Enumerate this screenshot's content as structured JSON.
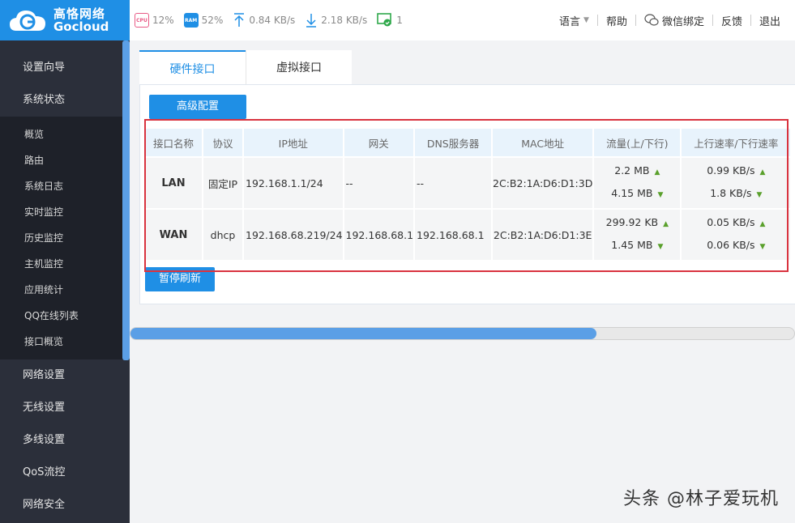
{
  "brand": {
    "cn": "高恪网络",
    "en": "Gocloud"
  },
  "stats": {
    "cpu_label": "CPU",
    "cpu": "12%",
    "ram_label": "RAM",
    "ram": "52%",
    "upload": "0.84 KB/s",
    "download": "2.18 KB/s",
    "devices": "1"
  },
  "topmenu": {
    "language": "语言",
    "help": "帮助",
    "wechat": "微信绑定",
    "feedback": "反馈",
    "logout": "退出"
  },
  "sidebar": {
    "top": [
      "设置向导",
      "系统状态"
    ],
    "sub": [
      "概览",
      "路由",
      "系统日志",
      "实时监控",
      "历史监控",
      "主机监控",
      "应用统计",
      "QQ在线列表",
      "接口概览"
    ],
    "bottom": [
      "网络设置",
      "无线设置",
      "多线设置",
      "QoS流控",
      "网络安全"
    ]
  },
  "tabs": [
    "硬件接口",
    "虚拟接口"
  ],
  "buttons": {
    "advanced": "高级配置",
    "pause": "暂停刷新"
  },
  "table": {
    "headers": [
      "接口名称",
      "协议",
      "IP地址",
      "网关",
      "DNS服务器",
      "MAC地址",
      "流量(上/下行)",
      "上行速率/下行速率"
    ],
    "rows": [
      {
        "name": "LAN",
        "protocol": "固定IP",
        "ip": "192.168.1.1/24",
        "gateway": "--",
        "dns": "--",
        "mac": "2C:B2:1A:D6:D1:3D",
        "traffic_up": "2.2 MB",
        "traffic_down": "4.15 MB",
        "rate_up": "0.99 KB/s",
        "rate_down": "1.8 KB/s"
      },
      {
        "name": "WAN",
        "protocol": "dhcp",
        "ip": "192.168.68.219/24",
        "gateway": "192.168.68.1",
        "dns": "192.168.68.1",
        "mac": "2C:B2:1A:D6:D1:3E",
        "traffic_up": "299.92 KB",
        "traffic_down": "1.45 MB",
        "rate_up": "0.05 KB/s",
        "rate_down": "0.06 KB/s"
      }
    ]
  },
  "watermark": "头条 @林子爱玩机",
  "colors": {
    "accent": "#1f8fe5",
    "highlight": "#d9333f",
    "sidebar": "#2b2f3a"
  }
}
